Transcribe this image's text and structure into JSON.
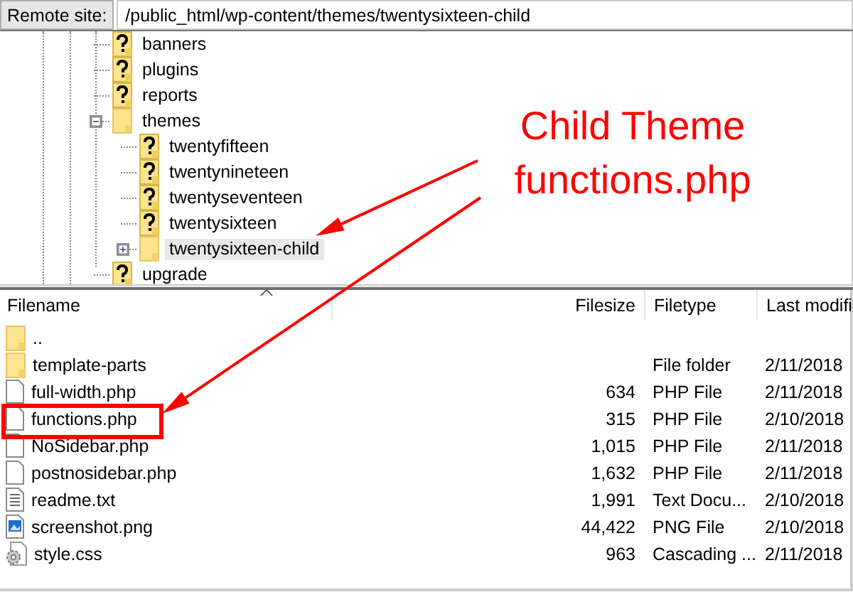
{
  "remote_site": {
    "label": "Remote site:",
    "path": "/public_html/wp-content/themes/twentysixteen-child"
  },
  "tree": [
    {
      "label": "banners",
      "kind": "unknown",
      "selected": false
    },
    {
      "label": "plugins",
      "kind": "unknown",
      "selected": false
    },
    {
      "label": "reports",
      "kind": "unknown",
      "selected": false
    },
    {
      "label": "themes",
      "kind": "folder",
      "expanded": true,
      "selected": false,
      "children": [
        {
          "label": "twentyfifteen",
          "kind": "unknown",
          "selected": false
        },
        {
          "label": "twentynineteen",
          "kind": "unknown",
          "selected": false
        },
        {
          "label": "twentyseventeen",
          "kind": "unknown",
          "selected": false
        },
        {
          "label": "twentysixteen",
          "kind": "unknown",
          "selected": false
        },
        {
          "label": "twentysixteen-child",
          "kind": "folder",
          "expanded": false,
          "selected": true
        }
      ]
    },
    {
      "label": "upgrade",
      "kind": "unknown",
      "selected": false
    }
  ],
  "file_list": {
    "columns": [
      "Filename",
      "Filesize",
      "Filetype",
      "Last modifi"
    ],
    "rows": [
      {
        "kind": "folder",
        "name": "..",
        "size": "",
        "type": "",
        "modified": ""
      },
      {
        "kind": "folder",
        "name": "template-parts",
        "type": "File folder",
        "modified": "2/11/2018"
      },
      {
        "kind": "file",
        "name": "full-width.php",
        "size": "634",
        "type": "PHP File",
        "modified": "2/11/2018"
      },
      {
        "kind": "file",
        "name": "functions.php",
        "size": "315",
        "type": "PHP File",
        "modified": "2/10/2018"
      },
      {
        "kind": "file",
        "name": "NoSidebar.php",
        "size": "1,015",
        "type": "PHP File",
        "modified": "2/11/2018"
      },
      {
        "kind": "file",
        "name": "postnosidebar.php",
        "size": "1,632",
        "type": "PHP File",
        "modified": "2/11/2018"
      },
      {
        "kind": "text",
        "name": "readme.txt",
        "size": "1,991",
        "type": "Text Docu...",
        "modified": "2/10/2018"
      },
      {
        "kind": "image",
        "name": "screenshot.png",
        "size": "44,422",
        "type": "PNG File",
        "modified": "2/10/2018"
      },
      {
        "kind": "gear",
        "name": "style.css",
        "size": "963",
        "type": "Cascading ...",
        "modified": "2/11/2018"
      }
    ]
  },
  "annotation": {
    "lines": [
      "Child Theme",
      "functions.php"
    ]
  }
}
